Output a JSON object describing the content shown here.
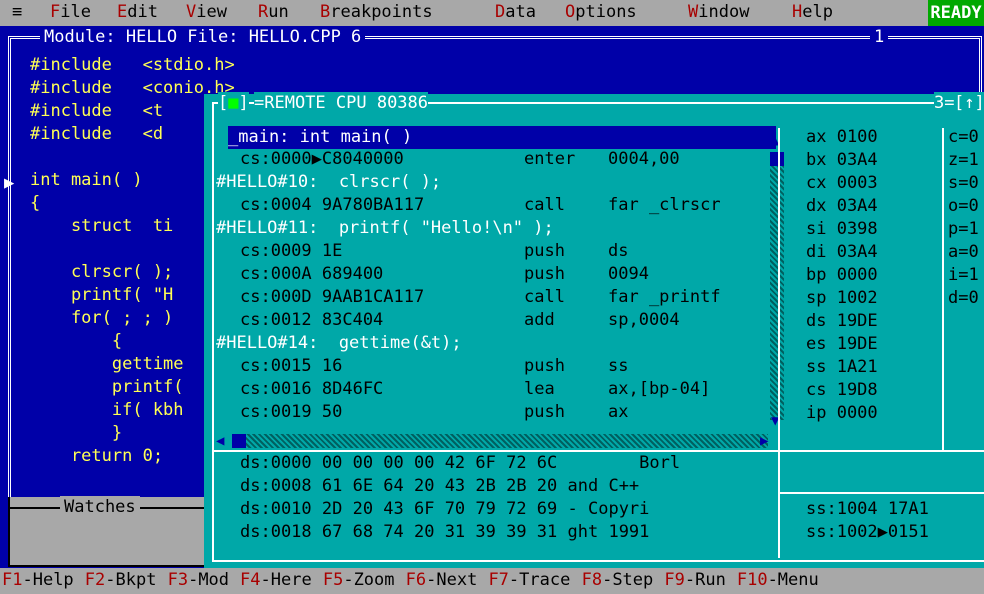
{
  "menubar": {
    "system": "≡",
    "items": [
      "File",
      "Edit",
      "View",
      "Run",
      "Breakpoints",
      "Data",
      "Options",
      "Window",
      "Help"
    ],
    "status": "READY"
  },
  "module": {
    "title": "Module: HELLO File: HELLO.CPP 6",
    "number": "1",
    "lines": [
      "#include   <stdio.h>",
      "#include   <conio.h>",
      "#include   <t",
      "#include   <d",
      "",
      "int main( )",
      "{",
      "    struct  ti",
      "",
      "    clrscr( );",
      "    printf( \"H",
      "    for( ; ; )",
      "        {",
      "        gettime",
      "        printf(",
      "        if( kbh",
      "        }",
      "    return 0;"
    ],
    "arrow_marker": "▶"
  },
  "watches": {
    "title": "Watches"
  },
  "cpu": {
    "title": "REMOTE CPU 80386",
    "close_box": "[■]",
    "number": "3",
    "resize": "[↑][↓]",
    "current": "_main: int main( )",
    "code": [
      {
        "addr": "cs:0000▶C8040000",
        "mn": "enter",
        "op": "0004,00"
      },
      {
        "src": "#HELLO#10:  clrscr( );"
      },
      {
        "addr": "cs:0004 9A780BA117",
        "mn": "call",
        "op": "far _clrscr"
      },
      {
        "src": "#HELLO#11:  printf( \"Hello!\\n\" );"
      },
      {
        "addr": "cs:0009 1E",
        "mn": "push",
        "op": "ds"
      },
      {
        "addr": "cs:000A 689400",
        "mn": "push",
        "op": "0094"
      },
      {
        "addr": "cs:000D 9AAB1CA117",
        "mn": "call",
        "op": "far _printf"
      },
      {
        "addr": "cs:0012 83C404",
        "mn": "add",
        "op": "sp,0004"
      },
      {
        "src": "#HELLO#14:  gettime(&t);"
      },
      {
        "addr": "cs:0015 16",
        "mn": "push",
        "op": "ss"
      },
      {
        "addr": "cs:0016 8D46FC",
        "mn": "lea",
        "op": "ax,[bp-04]"
      },
      {
        "addr": "cs:0019 50",
        "mn": "push",
        "op": "ax"
      }
    ],
    "registers": [
      "ax 0100",
      "bx 03A4",
      "cx 0003",
      "dx 03A4",
      "si 0398",
      "di 03A4",
      "bp 0000",
      "sp 1002",
      "ds 19DE",
      "es 19DE",
      "ss 1A21",
      "cs 19D8",
      "ip 0000"
    ],
    "flags": [
      "c=0",
      "z=1",
      "s=0",
      "o=0",
      "p=1",
      "a=0",
      "i=1",
      "d=0"
    ],
    "dump": [
      "ds:0000 00 00 00 00 42 6F 72 6C        Borl",
      "ds:0008 61 6E 64 20 43 2B 2B 20 and C++",
      "ds:0010 2D 20 43 6F 70 79 72 69 - Copyri",
      "ds:0018 67 68 74 20 31 39 39 31 ght 1991"
    ],
    "stack": [
      "ss:1004 17A1",
      "ss:1002▶0151"
    ]
  },
  "fkeys": [
    {
      "k": "F1",
      "l": "-Help"
    },
    {
      "k": "F2",
      "l": "-Bkpt"
    },
    {
      "k": "F3",
      "l": "-Mod"
    },
    {
      "k": "F4",
      "l": "-Here"
    },
    {
      "k": "F5",
      "l": "-Zoom"
    },
    {
      "k": "F6",
      "l": "-Next"
    },
    {
      "k": "F7",
      "l": "-Trace"
    },
    {
      "k": "F8",
      "l": "-Step"
    },
    {
      "k": "F9",
      "l": "-Run"
    },
    {
      "k": "F10",
      "l": "-Menu"
    }
  ]
}
